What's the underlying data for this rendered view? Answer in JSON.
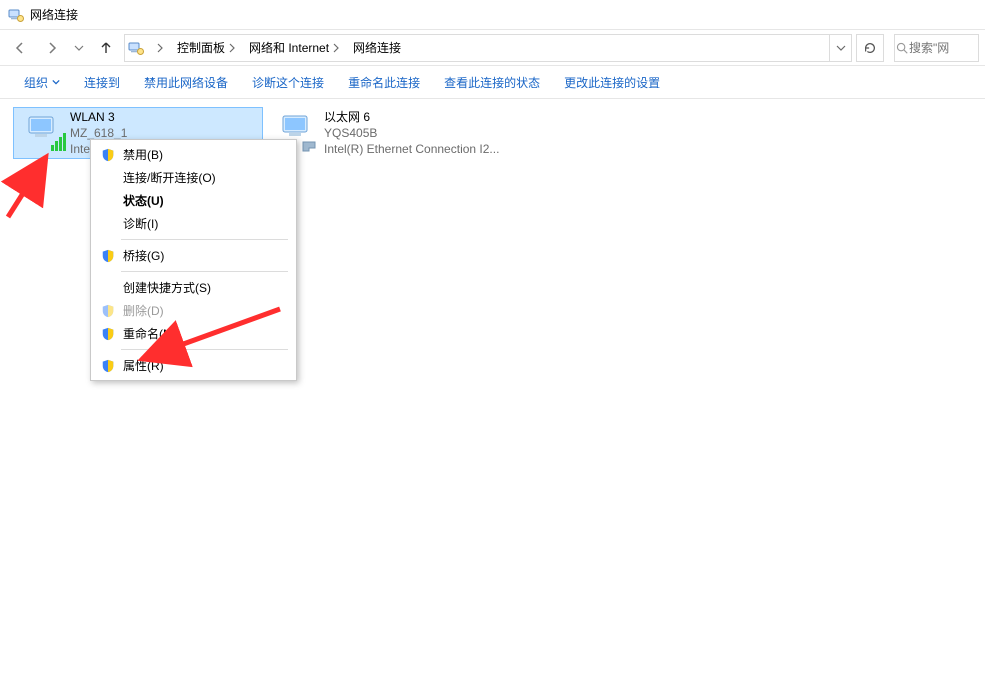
{
  "titlebar": {
    "title": "网络连接"
  },
  "breadcrumb": {
    "items": [
      "控制面板",
      "网络和 Internet",
      "网络连接"
    ]
  },
  "search": {
    "placeholder": "搜索\"网"
  },
  "cmdbar": {
    "organize": "组织",
    "items": [
      "连接到",
      "禁用此网络设备",
      "诊断这个连接",
      "重命名此连接",
      "查看此连接的状态",
      "更改此连接的设置"
    ]
  },
  "connections": [
    {
      "name": "WLAN 3",
      "line2": "MZ_618_1",
      "line3": "Inte",
      "selected": true,
      "type": "wifi"
    },
    {
      "name": "以太网 6",
      "line2": "YQS405B",
      "line3": "Intel(R) Ethernet Connection I2...",
      "selected": false,
      "type": "ethernet"
    }
  ],
  "contextmenu": {
    "items": [
      {
        "label": "禁用(B)",
        "shield": true
      },
      {
        "label": "连接/断开连接(O)"
      },
      {
        "label": "状态(U)",
        "bold": true
      },
      {
        "label": "诊断(I)"
      },
      {
        "sep": true
      },
      {
        "label": "桥接(G)",
        "shield": true
      },
      {
        "sep": true
      },
      {
        "label": "创建快捷方式(S)"
      },
      {
        "label": "删除(D)",
        "shield": true,
        "disabled": true
      },
      {
        "label": "重命名(M)",
        "shield": true
      },
      {
        "sep": true
      },
      {
        "label": "属性(R)",
        "shield": true
      }
    ]
  }
}
